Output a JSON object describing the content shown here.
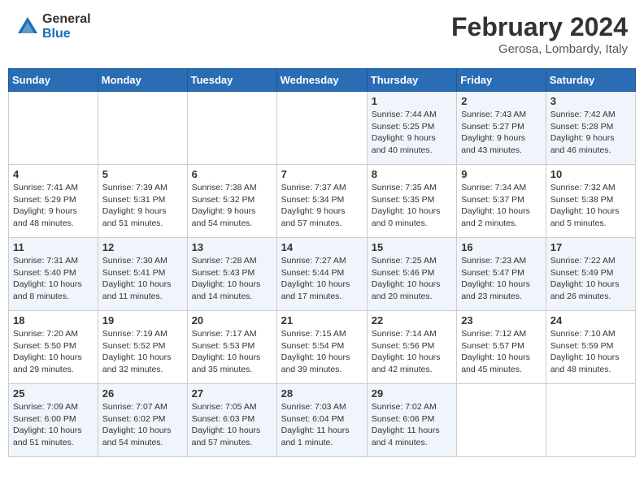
{
  "header": {
    "logo_general": "General",
    "logo_blue": "Blue",
    "month_year": "February 2024",
    "location": "Gerosa, Lombardy, Italy"
  },
  "weekdays": [
    "Sunday",
    "Monday",
    "Tuesday",
    "Wednesday",
    "Thursday",
    "Friday",
    "Saturday"
  ],
  "weeks": [
    {
      "days": [
        {
          "num": "",
          "info": ""
        },
        {
          "num": "",
          "info": ""
        },
        {
          "num": "",
          "info": ""
        },
        {
          "num": "",
          "info": ""
        },
        {
          "num": "1",
          "info": "Sunrise: 7:44 AM\nSunset: 5:25 PM\nDaylight: 9 hours\nand 40 minutes."
        },
        {
          "num": "2",
          "info": "Sunrise: 7:43 AM\nSunset: 5:27 PM\nDaylight: 9 hours\nand 43 minutes."
        },
        {
          "num": "3",
          "info": "Sunrise: 7:42 AM\nSunset: 5:28 PM\nDaylight: 9 hours\nand 46 minutes."
        }
      ]
    },
    {
      "days": [
        {
          "num": "4",
          "info": "Sunrise: 7:41 AM\nSunset: 5:29 PM\nDaylight: 9 hours\nand 48 minutes."
        },
        {
          "num": "5",
          "info": "Sunrise: 7:39 AM\nSunset: 5:31 PM\nDaylight: 9 hours\nand 51 minutes."
        },
        {
          "num": "6",
          "info": "Sunrise: 7:38 AM\nSunset: 5:32 PM\nDaylight: 9 hours\nand 54 minutes."
        },
        {
          "num": "7",
          "info": "Sunrise: 7:37 AM\nSunset: 5:34 PM\nDaylight: 9 hours\nand 57 minutes."
        },
        {
          "num": "8",
          "info": "Sunrise: 7:35 AM\nSunset: 5:35 PM\nDaylight: 10 hours\nand 0 minutes."
        },
        {
          "num": "9",
          "info": "Sunrise: 7:34 AM\nSunset: 5:37 PM\nDaylight: 10 hours\nand 2 minutes."
        },
        {
          "num": "10",
          "info": "Sunrise: 7:32 AM\nSunset: 5:38 PM\nDaylight: 10 hours\nand 5 minutes."
        }
      ]
    },
    {
      "days": [
        {
          "num": "11",
          "info": "Sunrise: 7:31 AM\nSunset: 5:40 PM\nDaylight: 10 hours\nand 8 minutes."
        },
        {
          "num": "12",
          "info": "Sunrise: 7:30 AM\nSunset: 5:41 PM\nDaylight: 10 hours\nand 11 minutes."
        },
        {
          "num": "13",
          "info": "Sunrise: 7:28 AM\nSunset: 5:43 PM\nDaylight: 10 hours\nand 14 minutes."
        },
        {
          "num": "14",
          "info": "Sunrise: 7:27 AM\nSunset: 5:44 PM\nDaylight: 10 hours\nand 17 minutes."
        },
        {
          "num": "15",
          "info": "Sunrise: 7:25 AM\nSunset: 5:46 PM\nDaylight: 10 hours\nand 20 minutes."
        },
        {
          "num": "16",
          "info": "Sunrise: 7:23 AM\nSunset: 5:47 PM\nDaylight: 10 hours\nand 23 minutes."
        },
        {
          "num": "17",
          "info": "Sunrise: 7:22 AM\nSunset: 5:49 PM\nDaylight: 10 hours\nand 26 minutes."
        }
      ]
    },
    {
      "days": [
        {
          "num": "18",
          "info": "Sunrise: 7:20 AM\nSunset: 5:50 PM\nDaylight: 10 hours\nand 29 minutes."
        },
        {
          "num": "19",
          "info": "Sunrise: 7:19 AM\nSunset: 5:52 PM\nDaylight: 10 hours\nand 32 minutes."
        },
        {
          "num": "20",
          "info": "Sunrise: 7:17 AM\nSunset: 5:53 PM\nDaylight: 10 hours\nand 35 minutes."
        },
        {
          "num": "21",
          "info": "Sunrise: 7:15 AM\nSunset: 5:54 PM\nDaylight: 10 hours\nand 39 minutes."
        },
        {
          "num": "22",
          "info": "Sunrise: 7:14 AM\nSunset: 5:56 PM\nDaylight: 10 hours\nand 42 minutes."
        },
        {
          "num": "23",
          "info": "Sunrise: 7:12 AM\nSunset: 5:57 PM\nDaylight: 10 hours\nand 45 minutes."
        },
        {
          "num": "24",
          "info": "Sunrise: 7:10 AM\nSunset: 5:59 PM\nDaylight: 10 hours\nand 48 minutes."
        }
      ]
    },
    {
      "days": [
        {
          "num": "25",
          "info": "Sunrise: 7:09 AM\nSunset: 6:00 PM\nDaylight: 10 hours\nand 51 minutes."
        },
        {
          "num": "26",
          "info": "Sunrise: 7:07 AM\nSunset: 6:02 PM\nDaylight: 10 hours\nand 54 minutes."
        },
        {
          "num": "27",
          "info": "Sunrise: 7:05 AM\nSunset: 6:03 PM\nDaylight: 10 hours\nand 57 minutes."
        },
        {
          "num": "28",
          "info": "Sunrise: 7:03 AM\nSunset: 6:04 PM\nDaylight: 11 hours\nand 1 minute."
        },
        {
          "num": "29",
          "info": "Sunrise: 7:02 AM\nSunset: 6:06 PM\nDaylight: 11 hours\nand 4 minutes."
        },
        {
          "num": "",
          "info": ""
        },
        {
          "num": "",
          "info": ""
        }
      ]
    }
  ]
}
